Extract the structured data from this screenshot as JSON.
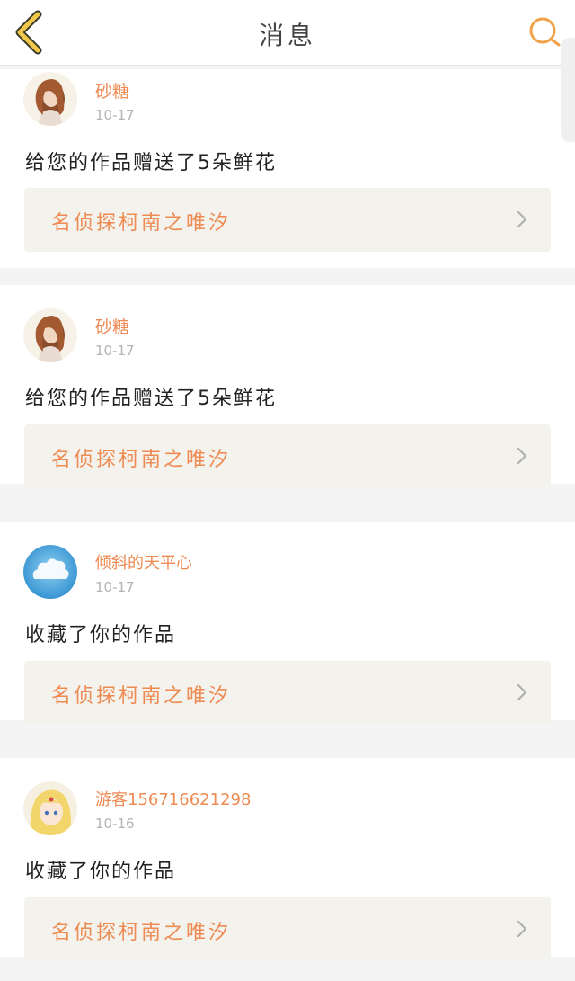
{
  "header": {
    "title": "消息",
    "back_icon": "chevron-left-icon",
    "search_icon": "search-icon",
    "accent_color": "#f0a24a"
  },
  "notifications": [
    {
      "user": "砂糖",
      "date": "10-17",
      "message": "给您的作品赠送了5朵鲜花",
      "work": "名侦探柯南之唯汐",
      "avatar": "portrait-woman"
    },
    {
      "user": "砂糖",
      "date": "10-17",
      "message": "给您的作品赠送了5朵鲜花",
      "work": "名侦探柯南之唯汐",
      "avatar": "portrait-woman"
    },
    {
      "user": "倾斜的天平心",
      "date": "10-17",
      "message": "收藏了你的作品",
      "work": "名侦探柯南之唯汐",
      "avatar": "cloud"
    },
    {
      "user": "游客15671662129​8",
      "date": "10-16",
      "message": "收藏了你的作品",
      "work": "名侦探柯南之唯汐",
      "avatar": "anime-girl"
    }
  ]
}
